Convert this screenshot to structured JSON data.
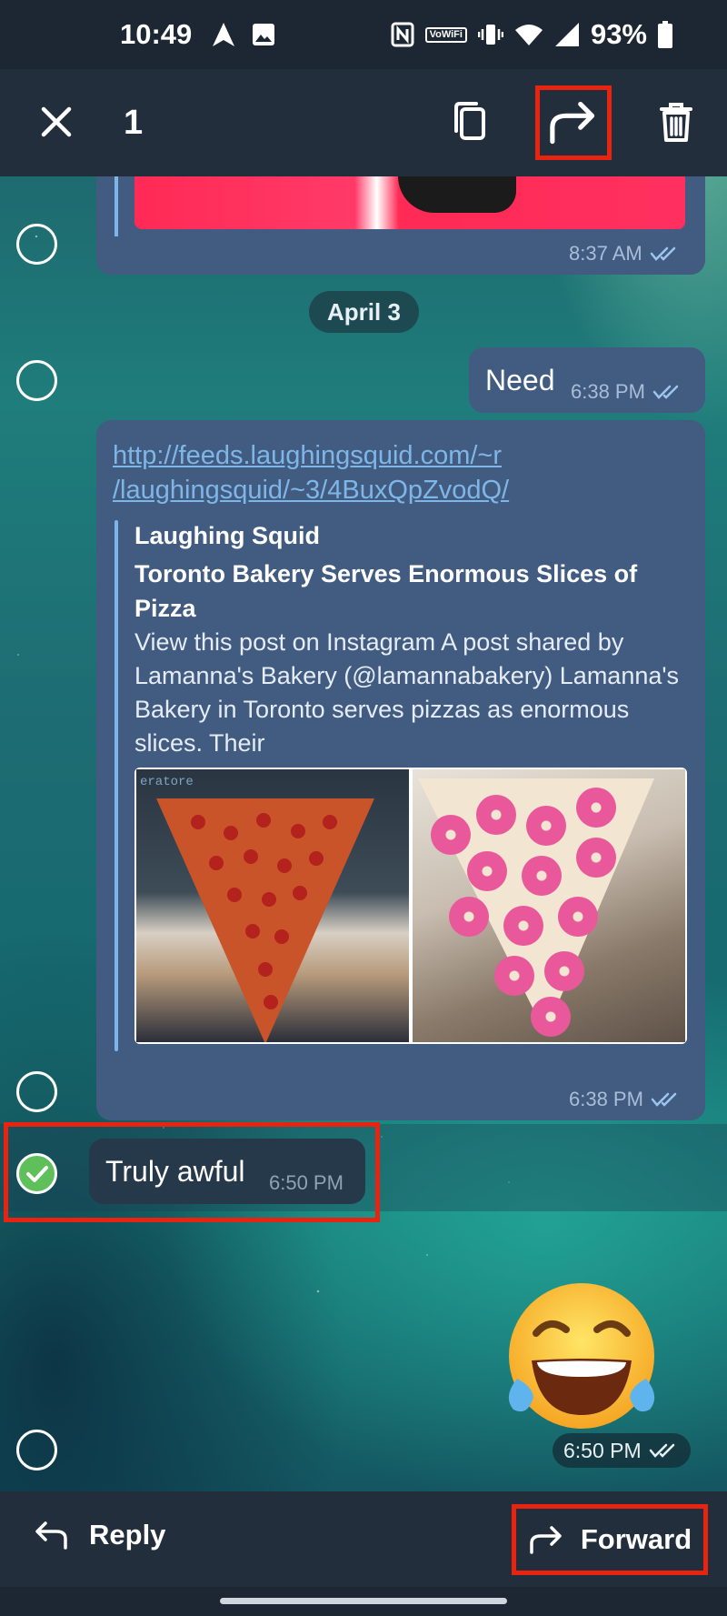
{
  "status_bar": {
    "time": "10:49",
    "battery": "93%",
    "volte_top": "Vo",
    "volte_bottom": "WiFi"
  },
  "action_bar": {
    "selected_count": "1",
    "icons": [
      "close-icon",
      "copy-icon",
      "forward-icon",
      "delete-icon"
    ]
  },
  "messages": {
    "top_media": {
      "time": "8:37 AM"
    },
    "date_chip": "April 3",
    "need": {
      "text": "Need",
      "time": "6:38 PM"
    },
    "link": {
      "url": "http://feeds.laughingsquid.com/~r/laughingsquid/~3/4BuxQpZvodQ/",
      "url_line1": "http://feeds.laughingsquid.com/~r",
      "url_line2": "/laughingsquid/~3/4BuxQpZvodQ/",
      "site_name": "Laughing Squid",
      "title": "Toronto Bakery Serves Enormous Slices of Pizza",
      "description": "View this post on Instagram A post shared by Lamanna's Bakery (@lamannabakery) Lamanna's Bakery in Toronto serves pizzas as enormous slices. Their",
      "image_caption": "eratore",
      "time": "6:38 PM"
    },
    "incoming": {
      "text": "Truly awful",
      "time": "6:50 PM",
      "selected": true
    },
    "emoji": {
      "name": "face-with-tears-of-joy",
      "time": "6:50 PM"
    }
  },
  "bottom_bar": {
    "reply_label": "Reply",
    "forward_label": "Forward"
  },
  "colors": {
    "highlight": "#e8230f",
    "outgoing_bubble": "#415c80",
    "incoming_bubble": "#26394b",
    "link": "#7fb6e8",
    "check_green": "#5fbf5b"
  }
}
